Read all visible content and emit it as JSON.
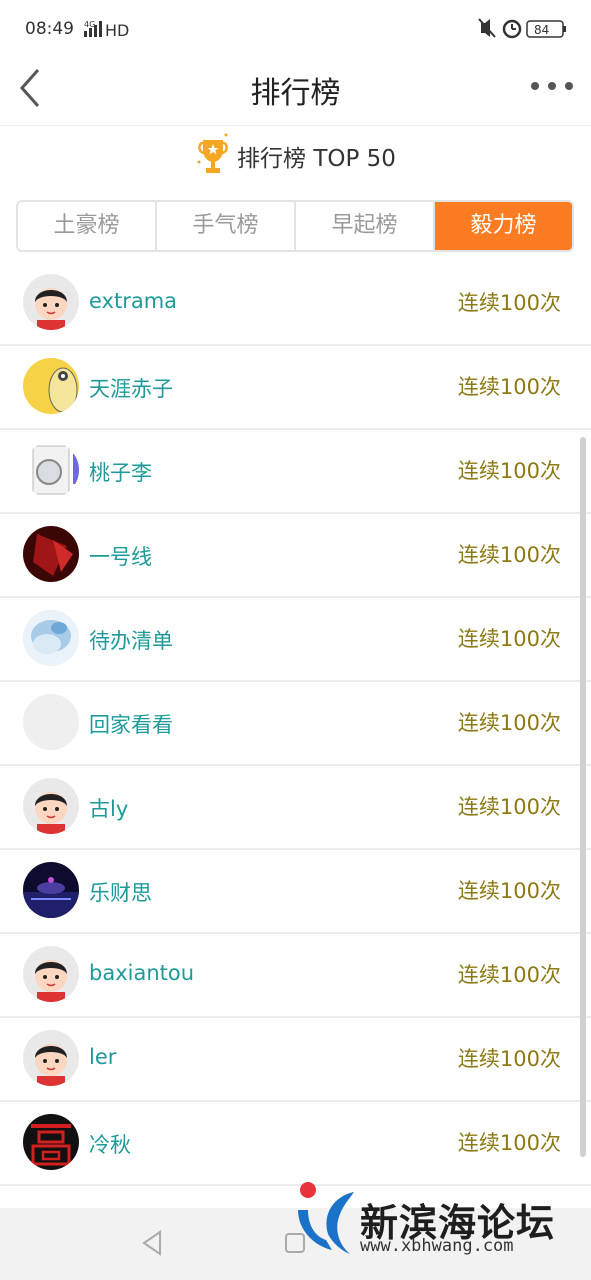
{
  "status_bar": {
    "time": "08:49",
    "network": "4G",
    "hd": "HD",
    "battery": "84"
  },
  "nav": {
    "title": "排行榜"
  },
  "banner": {
    "title": "排行榜 TOP 50"
  },
  "tabs": [
    {
      "label": "土豪榜",
      "active": false
    },
    {
      "label": "手气榜",
      "active": false
    },
    {
      "label": "早起榜",
      "active": false
    },
    {
      "label": "毅力榜",
      "active": true
    }
  ],
  "rows": [
    {
      "name": "extrama",
      "count": "连续100次",
      "avatar": "cartoon-boy-avatar"
    },
    {
      "name": "天涯赤子",
      "count": "连续100次",
      "avatar": "yellow-cartoon-avatar"
    },
    {
      "name": "桃子李",
      "count": "连续100次",
      "avatar": "washing-machine-avatar"
    },
    {
      "name": "一号线",
      "count": "连续100次",
      "avatar": "dark-red-avatar"
    },
    {
      "name": "待办清单",
      "count": "连续100次",
      "avatar": "blue-ice-avatar"
    },
    {
      "name": "回家看看",
      "count": "连续100次",
      "avatar": "blank-avatar"
    },
    {
      "name": "古ly",
      "count": "连续100次",
      "avatar": "cartoon-boy-avatar"
    },
    {
      "name": "乐财思",
      "count": "连续100次",
      "avatar": "night-scene-avatar"
    },
    {
      "name": "baxiantou",
      "count": "连续100次",
      "avatar": "cartoon-boy-avatar"
    },
    {
      "name": "ler",
      "count": "连续100次",
      "avatar": "cartoon-boy-avatar"
    },
    {
      "name": "冷秋",
      "count": "连续100次",
      "avatar": "red-character-avatar"
    }
  ],
  "watermark": {
    "text": "新滨海论坛",
    "url": "www.xbhwang.com"
  },
  "colors": {
    "accent": "#fb7c22",
    "name_text": "#1e9a9a",
    "count_text": "#8c7a16"
  }
}
